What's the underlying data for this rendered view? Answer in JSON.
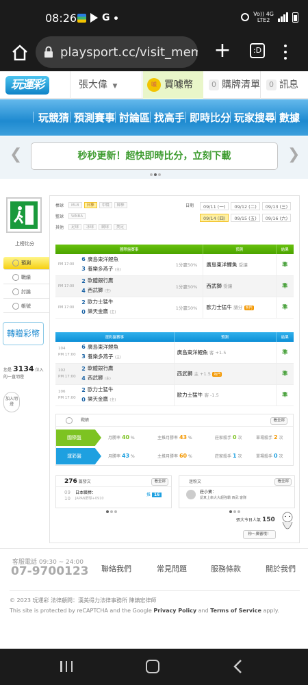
{
  "status_bar": {
    "time": "08:26",
    "network_top": "Vo)) 4G",
    "network_bottom": "LTE2"
  },
  "browser": {
    "url": "playsport.cc/visit_mem",
    "tab_count": ":D"
  },
  "site_header": {
    "logo": "玩運彩",
    "username": "張大偉",
    "coins_label": "買噱幣",
    "coin_icon": "噱",
    "cart_label": "購牌清單",
    "cart_count": "0",
    "messages_label": "訊息",
    "messages_count": "0"
  },
  "nav": [
    "玩競猜",
    "預測賽事",
    "討論區",
    "找高手",
    "即時比分",
    "玩家搜尋",
    "數據"
  ],
  "banner": {
    "text": "秒秒更新！超快即時比分，立刻下載"
  },
  "sidebar": {
    "exit_label": "上榜比分",
    "tabs": [
      {
        "label": "預測"
      },
      {
        "label": "戰績"
      },
      {
        "label": "討論"
      },
      {
        "label": "帳號"
      }
    ],
    "convert_button": "轉贈彩幣",
    "intro_prefix": "您是",
    "intro_count": "3134",
    "intro_suffix": "位入的一直明燈",
    "join_label": "加入明燈"
  },
  "filters": {
    "row1_label": "棒球",
    "row1": [
      "MLB",
      "日棒",
      "中職",
      "韓棒"
    ],
    "row1_active": 1,
    "row2_label": "籃球",
    "row2": [
      "WNBA"
    ],
    "row3_label": "其他",
    "row3": [
      "足球",
      "冰球",
      "網球",
      "美足"
    ],
    "date_label": "日期",
    "dates_row1": [
      "09/11 (一)",
      "09/12 (二)",
      "09/13 (三)"
    ],
    "dates_row2": [
      "09/14 (四)",
      "09/15 (五)",
      "09/16 (六)"
    ],
    "active_date": "09/14 (四)"
  },
  "intl_table": {
    "headers": [
      "國際盤賽事",
      "預測",
      "結果"
    ],
    "rows": [
      {
        "time": "PM 17:00",
        "s1": "6",
        "t1": "廣島東洋鯉魚",
        "s2": "3",
        "t2": "養樂多燕子",
        "tag": "(主)",
        "odds": "1分贏50%",
        "pick": "廣島東洋鯉魚",
        "pick_note": "受讓",
        "hot": "",
        "result": "準"
      },
      {
        "time": "PM 17:00",
        "s1": "2",
        "t1": "軟體銀行鷹",
        "s2": "4",
        "t2": "西武獅",
        "tag": "(主)",
        "odds": "1分贏50%",
        "pick": "西武獅",
        "pick_note": "受讓",
        "hot": "",
        "result": "準"
      },
      {
        "time": "PM 17:00",
        "s1": "2",
        "t1": "歐力士猛牛",
        "s2": "0",
        "t2": "樂天金鷹",
        "tag": "(主)",
        "odds": "1分贏50%",
        "pick": "歐力士猛牛",
        "pick_note": "讓分",
        "hot": "熱門",
        "result": "準"
      }
    ]
  },
  "lottery_table": {
    "headers": [
      "運彩盤賽事",
      "預測",
      "結果"
    ],
    "rows": [
      {
        "num": "104",
        "time": "PM 17:00",
        "s1": "6",
        "t1": "廣島東洋鯉魚",
        "s2": "3",
        "t2": "養樂多燕子",
        "tag": "(主)",
        "pick": "廣島東洋鯉魚",
        "pick_note": "客 +1.5",
        "hot": "",
        "result": "準"
      },
      {
        "num": "102",
        "time": "PM 17:00",
        "s1": "2",
        "t1": "軟體銀行鷹",
        "s2": "4",
        "t2": "西武獅",
        "tag": "(主)",
        "pick": "西武獅",
        "pick_note": "主 +1.5",
        "hot": "熱門",
        "result": "準"
      },
      {
        "num": "106",
        "time": "PM 17:00",
        "s1": "2",
        "t1": "歐力士猛牛",
        "s2": "0",
        "t2": "樂天金鷹",
        "tag": "(主)",
        "pick": "歐力士猛牛",
        "pick_note": "客 -1.5",
        "hot": "",
        "result": "準"
      }
    ]
  },
  "record": {
    "title": "戰績",
    "view_all": "看全部",
    "rows": [
      {
        "band": "國際盤",
        "color": "#7dc322",
        "month_label": "月勝率",
        "month": "40",
        "home_label": "主推月勝率",
        "home": "43",
        "streak_label": "莊家殺手",
        "streak": "0",
        "single_label": "單場殺手",
        "single": "2",
        "unit": "次"
      },
      {
        "band": "運彩盤",
        "color": "#1ea0e0",
        "month_label": "月勝率",
        "month": "43",
        "home_label": "主推月勝率",
        "home": "60",
        "streak_label": "莊家殺手",
        "streak": "1",
        "single_label": "單場殺手",
        "single": "0",
        "unit": "次"
      }
    ]
  },
  "articles": {
    "count": "276",
    "label": "篇發文",
    "view_all": "看全部",
    "date_top": "09",
    "date_bottom": "10",
    "title": "日本職棒：",
    "subtitle": "JAPAN野球+0910",
    "push_label": "推",
    "push_count": "16"
  },
  "fans": {
    "label": "迷粉文",
    "view_all": "看全部",
    "name": "莊小寶：",
    "text": "認真上串大大超強霸 西武 客隊",
    "popularity_label": "張大今日人氣",
    "popularity": "150",
    "fans_button": "粉～廣審哦！"
  },
  "footer": {
    "hotline": "客服電話 09:30 ~ 24:00",
    "phone": "07-9700123",
    "links": [
      "聯絡我們",
      "常見問題",
      "服務條款",
      "關於我們"
    ],
    "copyright": "© 2023 玩運彩 法律顧問：漢美得力法律事務所 陳鎮宏律師",
    "legal_prefix": "This site is protected by reCAPTCHA and the Google ",
    "privacy": "Privacy Policy",
    "legal_and": " and ",
    "terms": "Terms of Service",
    "legal_suffix": " apply."
  }
}
